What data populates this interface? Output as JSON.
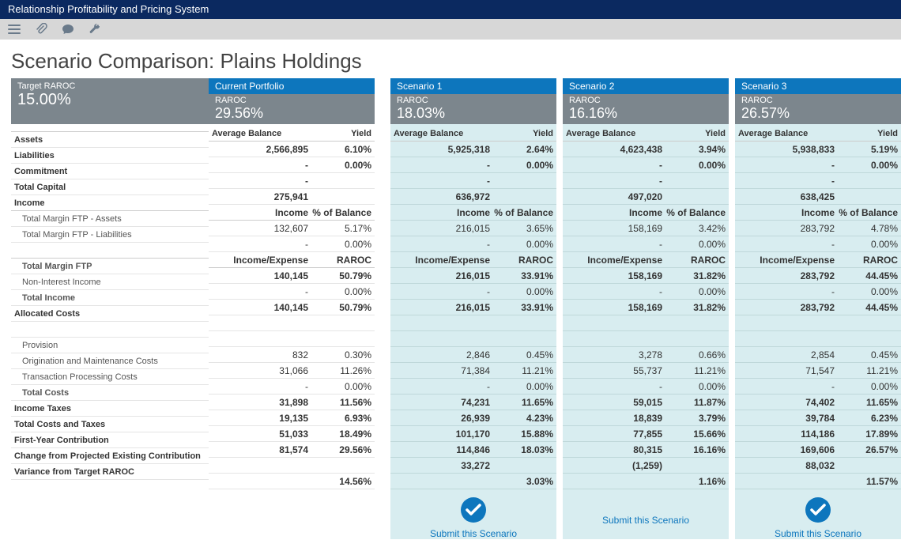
{
  "app_title": "Relationship Profitability and Pricing System",
  "page_title": "Scenario Comparison: Plains Holdings",
  "target": {
    "label": "Target RAROC",
    "value": "15.00%"
  },
  "raroc_label": "RAROC",
  "colheads": {
    "avg_bal": "Average Balance",
    "yield": "Yield",
    "income": "Income",
    "pct_bal": "% of Balance",
    "inc_exp": "Income/Expense",
    "raroc": "RAROC"
  },
  "row_labels": {
    "assets": "Assets",
    "liabilities": "Liabilities",
    "commitment": "Commitment",
    "total_capital": "Total Capital",
    "income": "Income",
    "tmftp_assets": "Total Margin FTP - Assets",
    "tmftp_liab": "Total Margin FTP - Liabilities",
    "tmftp": "Total Margin FTP",
    "nii": "Non-Interest Income",
    "total_income": "Total Income",
    "alloc": "Allocated Costs",
    "provision": "Provision",
    "orig": "Origination and Maintenance Costs",
    "txn": "Transaction Processing Costs",
    "total_costs": "Total Costs",
    "income_taxes": "Income Taxes",
    "total_ct": "Total Costs and Taxes",
    "fyc": "First-Year Contribution",
    "change": "Change from Projected Existing Contribution",
    "variance": "Variance from Target RAROC"
  },
  "columns": [
    {
      "id": "current",
      "title": "Current Portfolio",
      "raroc": "29.56%",
      "scen_bg": false,
      "submit": null,
      "data": {
        "assets": [
          "2,566,895",
          "6.10%"
        ],
        "liabilities": [
          "-",
          "0.00%"
        ],
        "commitment": [
          "-",
          ""
        ],
        "total_capital": [
          "275,941",
          ""
        ],
        "tmftp_assets": [
          "132,607",
          "5.17%"
        ],
        "tmftp_liab": [
          "-",
          "0.00%"
        ],
        "tmftp": [
          "140,145",
          "50.79%"
        ],
        "nii": [
          "-",
          "0.00%"
        ],
        "total_income": [
          "140,145",
          "50.79%"
        ],
        "provision": [
          "832",
          "0.30%"
        ],
        "orig": [
          "31,066",
          "11.26%"
        ],
        "txn": [
          "-",
          "0.00%"
        ],
        "total_costs": [
          "31,898",
          "11.56%"
        ],
        "income_taxes": [
          "19,135",
          "6.93%"
        ],
        "total_ct": [
          "51,033",
          "18.49%"
        ],
        "fyc": [
          "81,574",
          "29.56%"
        ],
        "change": [
          "",
          ""
        ],
        "variance": [
          "",
          "14.56%"
        ]
      }
    },
    {
      "id": "s1",
      "title": "Scenario 1",
      "raroc": "18.03%",
      "scen_bg": true,
      "submit": "icon",
      "data": {
        "assets": [
          "5,925,318",
          "2.64%"
        ],
        "liabilities": [
          "-",
          "0.00%"
        ],
        "commitment": [
          "-",
          ""
        ],
        "total_capital": [
          "636,972",
          ""
        ],
        "tmftp_assets": [
          "216,015",
          "3.65%"
        ],
        "tmftp_liab": [
          "-",
          "0.00%"
        ],
        "tmftp": [
          "216,015",
          "33.91%"
        ],
        "nii": [
          "-",
          "0.00%"
        ],
        "total_income": [
          "216,015",
          "33.91%"
        ],
        "provision": [
          "2,846",
          "0.45%"
        ],
        "orig": [
          "71,384",
          "11.21%"
        ],
        "txn": [
          "-",
          "0.00%"
        ],
        "total_costs": [
          "74,231",
          "11.65%"
        ],
        "income_taxes": [
          "26,939",
          "4.23%"
        ],
        "total_ct": [
          "101,170",
          "15.88%"
        ],
        "fyc": [
          "114,846",
          "18.03%"
        ],
        "change": [
          "33,272",
          ""
        ],
        "variance": [
          "",
          "3.03%"
        ]
      }
    },
    {
      "id": "s2",
      "title": "Scenario 2",
      "raroc": "16.16%",
      "scen_bg": true,
      "submit": "text",
      "data": {
        "assets": [
          "4,623,438",
          "3.94%"
        ],
        "liabilities": [
          "-",
          "0.00%"
        ],
        "commitment": [
          "-",
          ""
        ],
        "total_capital": [
          "497,020",
          ""
        ],
        "tmftp_assets": [
          "158,169",
          "3.42%"
        ],
        "tmftp_liab": [
          "-",
          "0.00%"
        ],
        "tmftp": [
          "158,169",
          "31.82%"
        ],
        "nii": [
          "-",
          "0.00%"
        ],
        "total_income": [
          "158,169",
          "31.82%"
        ],
        "provision": [
          "3,278",
          "0.66%"
        ],
        "orig": [
          "55,737",
          "11.21%"
        ],
        "txn": [
          "-",
          "0.00%"
        ],
        "total_costs": [
          "59,015",
          "11.87%"
        ],
        "income_taxes": [
          "18,839",
          "3.79%"
        ],
        "total_ct": [
          "77,855",
          "15.66%"
        ],
        "fyc": [
          "80,315",
          "16.16%"
        ],
        "change": [
          "(1,259)",
          ""
        ],
        "variance": [
          "",
          "1.16%"
        ]
      }
    },
    {
      "id": "s3",
      "title": "Scenario 3",
      "raroc": "26.57%",
      "scen_bg": true,
      "submit": "icon",
      "data": {
        "assets": [
          "5,938,833",
          "5.19%"
        ],
        "liabilities": [
          "-",
          "0.00%"
        ],
        "commitment": [
          "-",
          ""
        ],
        "total_capital": [
          "638,425",
          ""
        ],
        "tmftp_assets": [
          "283,792",
          "4.78%"
        ],
        "tmftp_liab": [
          "-",
          "0.00%"
        ],
        "tmftp": [
          "283,792",
          "44.45%"
        ],
        "nii": [
          "-",
          "0.00%"
        ],
        "total_income": [
          "283,792",
          "44.45%"
        ],
        "provision": [
          "2,854",
          "0.45%"
        ],
        "orig": [
          "71,547",
          "11.21%"
        ],
        "txn": [
          "-",
          "0.00%"
        ],
        "total_costs": [
          "74,402",
          "11.65%"
        ],
        "income_taxes": [
          "39,784",
          "6.23%"
        ],
        "total_ct": [
          "114,186",
          "17.89%"
        ],
        "fyc": [
          "169,606",
          "26.57%"
        ],
        "change": [
          "88,032",
          ""
        ],
        "variance": [
          "",
          "11.57%"
        ]
      }
    }
  ],
  "submit_label": "Submit this Scenario"
}
